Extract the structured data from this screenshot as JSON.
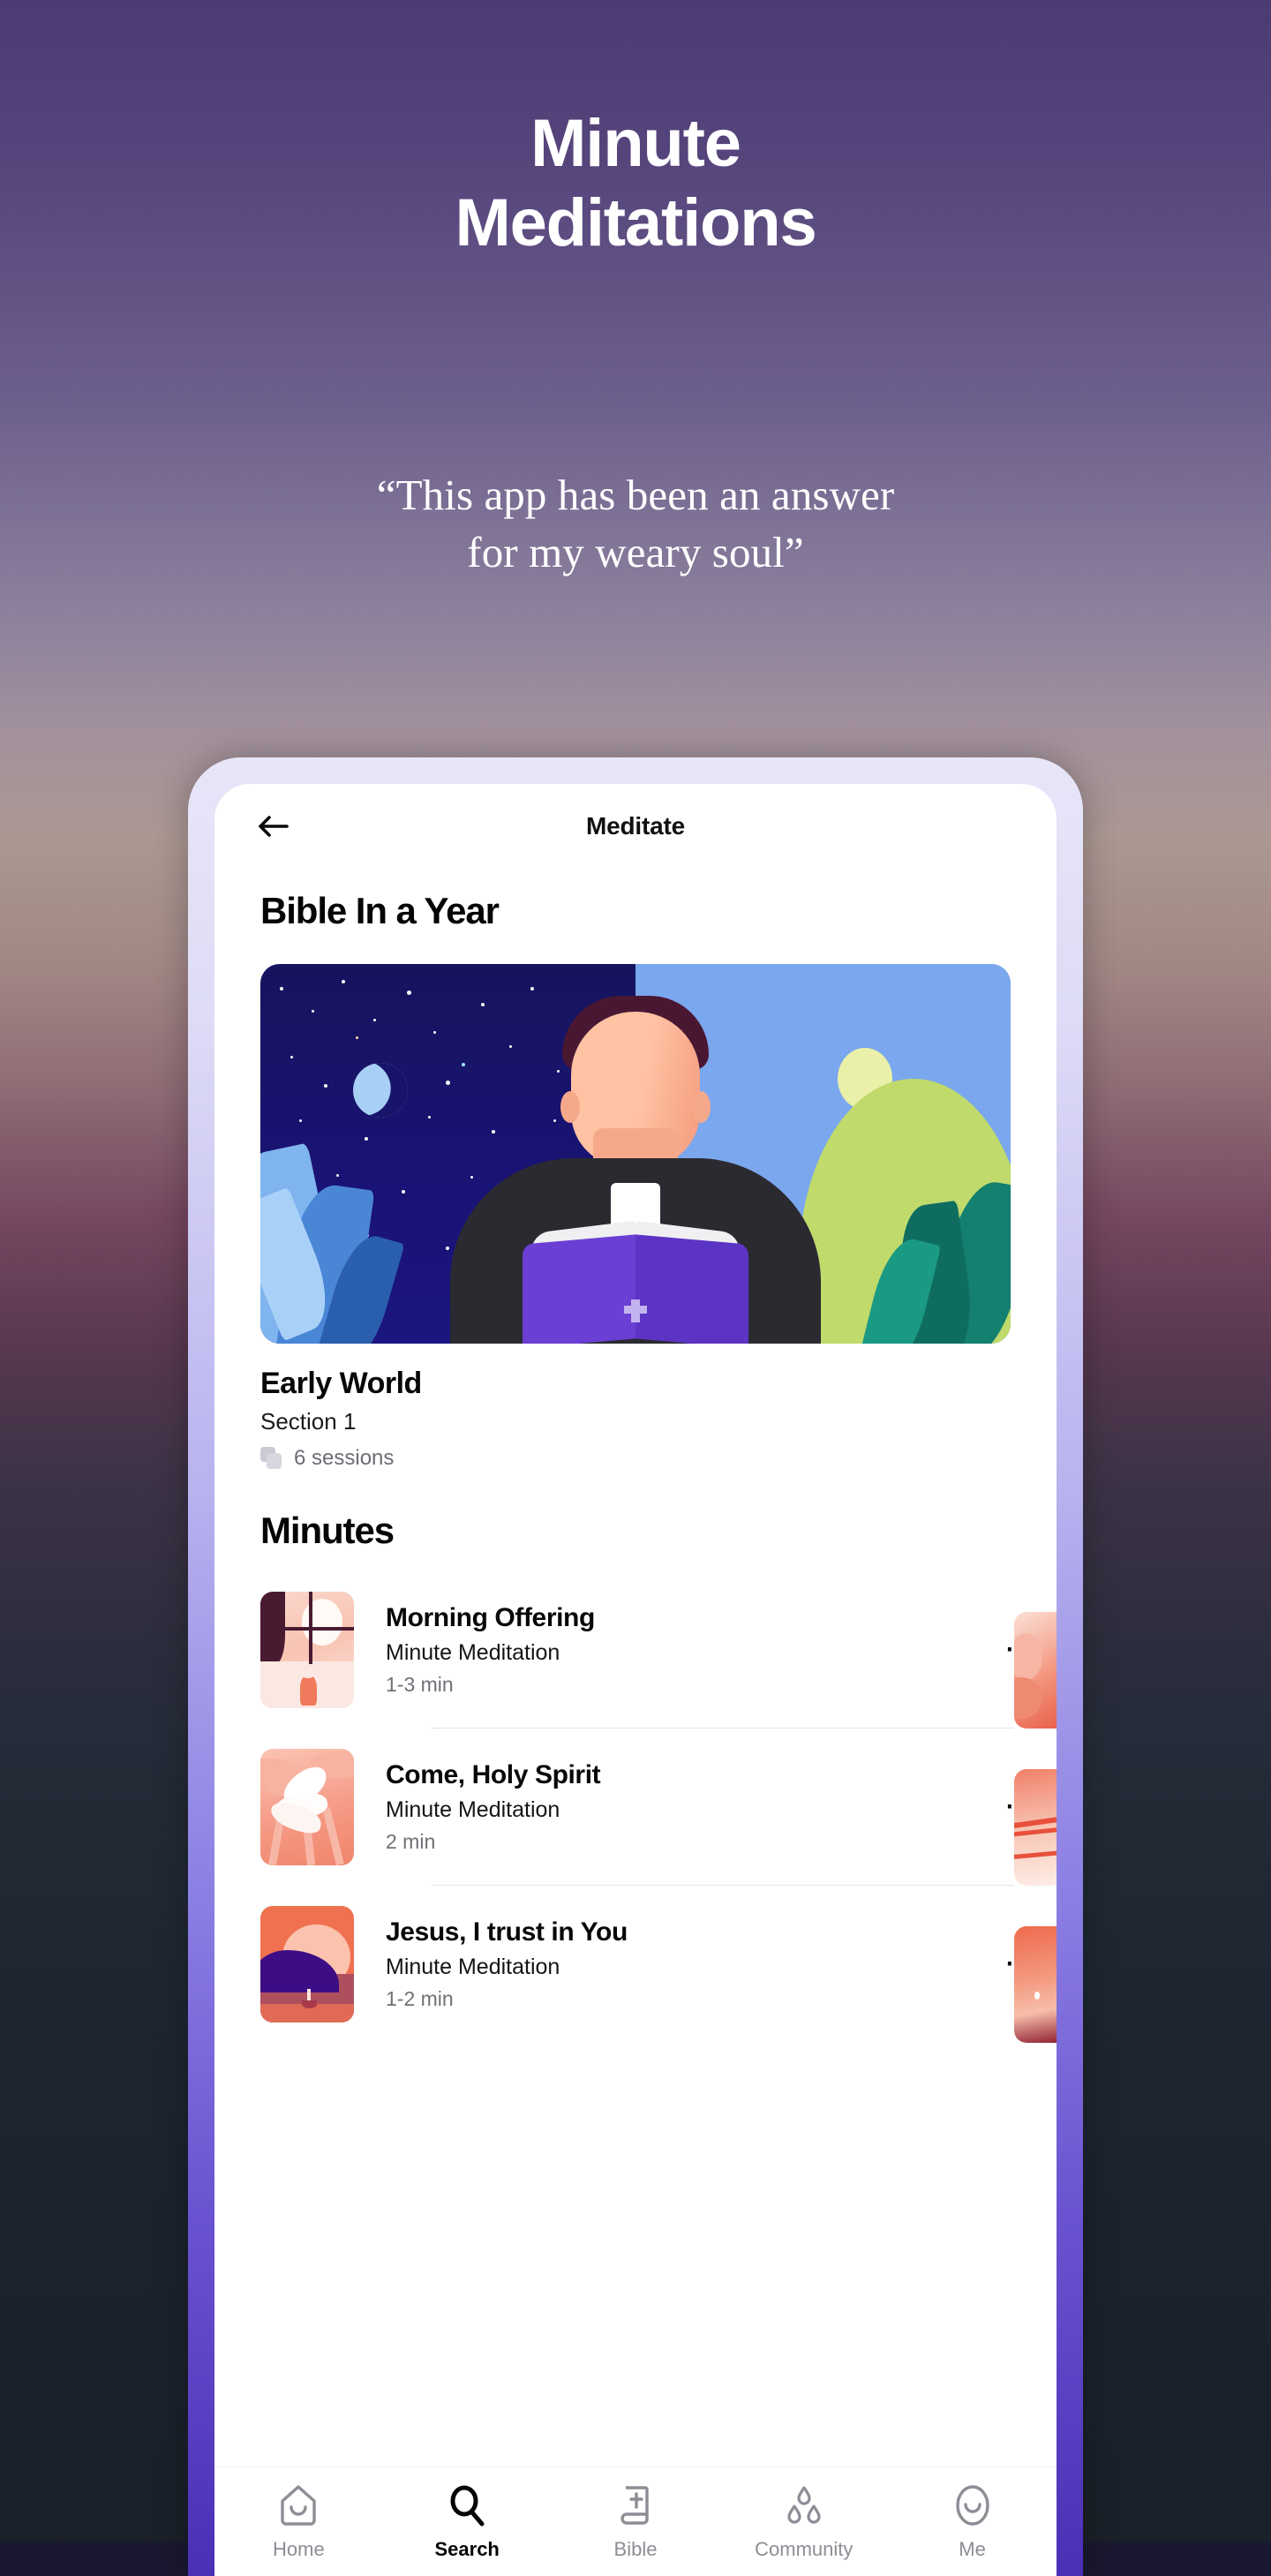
{
  "promo": {
    "headline_line1": "Minute",
    "headline_line2": "Meditations",
    "quote": "“This app has been an answer for my weary soul”"
  },
  "app": {
    "header": {
      "back_icon": "arrow-left-icon",
      "title": "Meditate"
    },
    "sections": {
      "bible_in_a_year": "Bible In a Year",
      "minutes": "Minutes"
    },
    "hero": {
      "image_alt": "priest-reading-bible-day-night-illustration",
      "name": "Early World",
      "section": "Section 1",
      "sessions": "6 sessions",
      "sessions_icon": "stacked-cards-icon"
    },
    "minutes_list": [
      {
        "title": "Morning Offering",
        "subtitle": "Minute Meditation",
        "duration": "1-3 min",
        "thumb": "window-sunrise-room-thumb",
        "more_icon": "more-horizontal-icon"
      },
      {
        "title": "Come, Holy Spirit",
        "subtitle": "Minute Meditation",
        "duration": "2 min",
        "thumb": "dove-thumb",
        "more_icon": "more-horizontal-icon"
      },
      {
        "title": "Jesus, I trust in You",
        "subtitle": "Minute Meditation",
        "duration": "1-2 min",
        "thumb": "sunset-mountain-water-thumb",
        "more_icon": "more-horizontal-icon"
      }
    ],
    "bottom_nav": [
      {
        "label": "Home",
        "icon": "home-shield-smile-icon",
        "active": false
      },
      {
        "label": "Search",
        "icon": "magnifier-icon",
        "active": true
      },
      {
        "label": "Bible",
        "icon": "book-cross-icon",
        "active": false
      },
      {
        "label": "Community",
        "icon": "people-group-icon",
        "active": false
      },
      {
        "label": "Me",
        "icon": "person-smile-oval-icon",
        "active": false
      }
    ]
  },
  "colors": {
    "accent_purple": "#4b2fb5",
    "bezel_light": "#e7e6f8",
    "nav_active": "#060606",
    "nav_inactive": "#8d8d95",
    "hero_night": "#191374",
    "hero_day": "#7aa7ee",
    "hero_book": "#6a3fd4"
  }
}
